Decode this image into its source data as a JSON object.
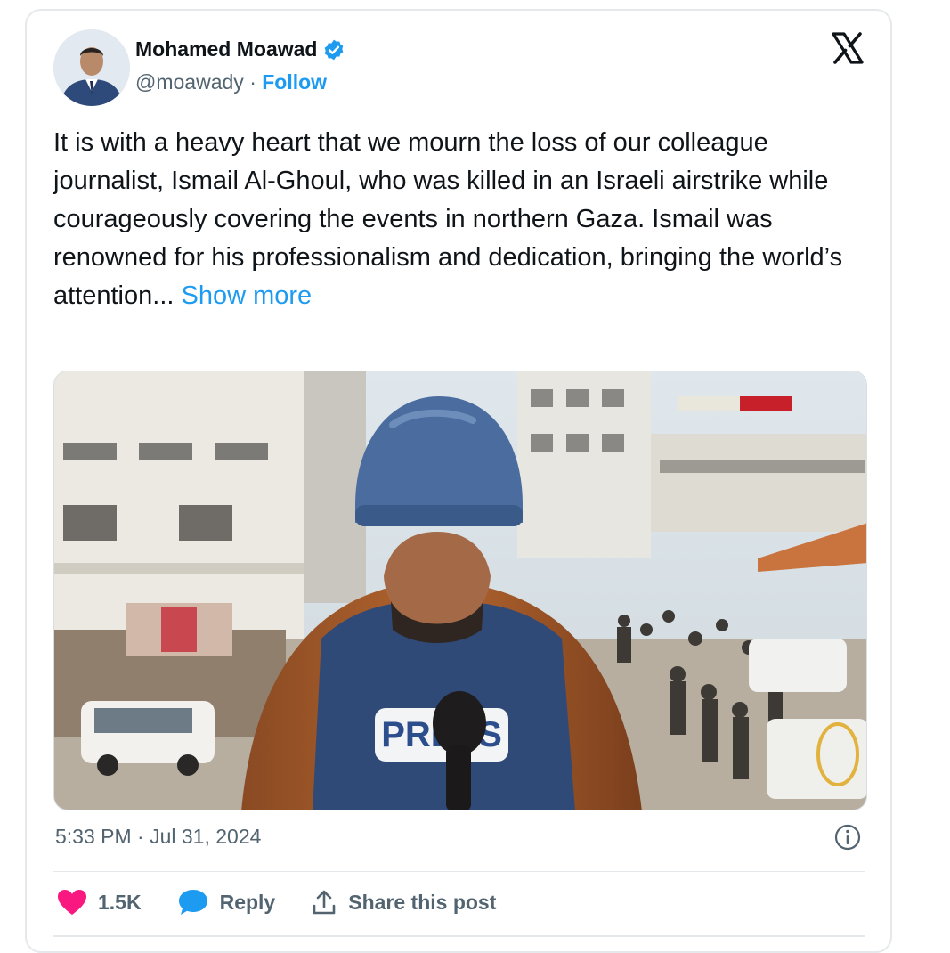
{
  "author": {
    "name": "Mohamed Moawad",
    "handle": "@moawady",
    "separator": "·",
    "follow_label": "Follow"
  },
  "tweet": {
    "text": "It is with a heavy heart that we mourn the loss of our colleague journalist, Ismail Al-Ghoul, who was killed in an Israeli airstrike while courageously covering the events in northern Gaza. Ismail was renowned for his professionalism and dedication, bringing the world’s attention...",
    "show_more_label": "Show more",
    "vest_text": "PRESS"
  },
  "timestamp": "5:33 PM · Jul 31, 2024",
  "actions": {
    "likes": "1.5K",
    "reply_label": "Reply",
    "share_label": "Share this post"
  },
  "colors": {
    "accent": "#1d9bf0",
    "like": "#f91880",
    "text": "#0f1419",
    "muted": "#536471"
  },
  "icons": [
    "verified-badge-icon",
    "x-logo-icon",
    "info-icon",
    "heart-icon",
    "reply-bubble-icon",
    "share-icon"
  ]
}
